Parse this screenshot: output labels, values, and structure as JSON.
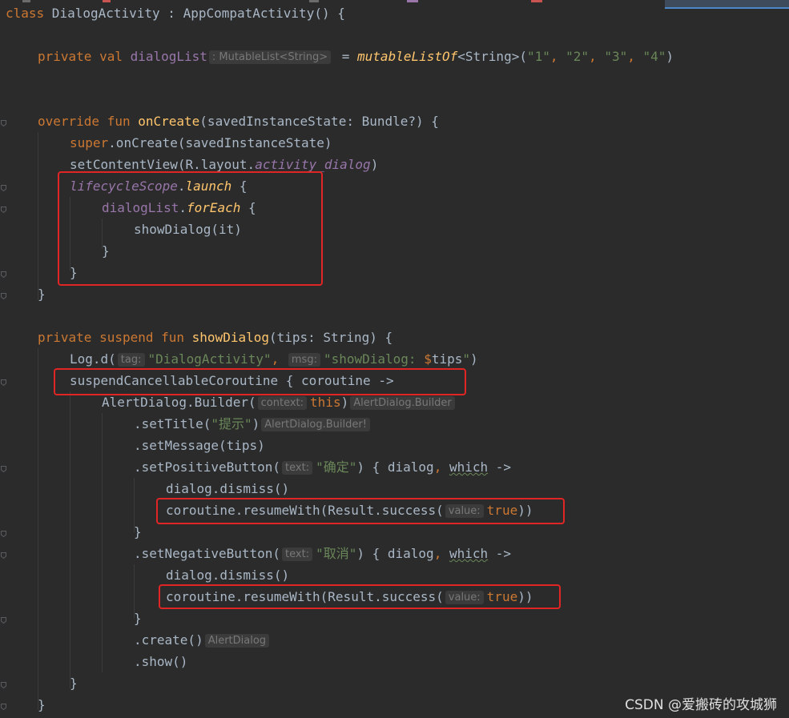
{
  "editor": {
    "language": "Kotlin",
    "lines": [
      {
        "indent": 0,
        "tokens": [
          [
            "kw",
            "class"
          ],
          [
            "p",
            " DialogActivity : AppCompatActivity() {"
          ]
        ]
      },
      {
        "indent": 0,
        "tokens": []
      },
      {
        "indent": 1,
        "tokens": [
          [
            "kw",
            "private val "
          ],
          [
            "prop",
            "dialogList"
          ],
          [
            "hint",
            ": MutableList<String>"
          ],
          [
            "p",
            " = "
          ],
          [
            "ext",
            "mutableListOf"
          ],
          [
            "p",
            "<String>("
          ],
          [
            "str",
            "\"1\""
          ],
          [
            "kw",
            ", "
          ],
          [
            "str",
            "\"2\""
          ],
          [
            "kw",
            ", "
          ],
          [
            "str",
            "\"3\""
          ],
          [
            "kw",
            ", "
          ],
          [
            "str",
            "\"4\""
          ],
          [
            "p",
            ")"
          ]
        ]
      },
      {
        "indent": 0,
        "tokens": []
      },
      {
        "indent": 0,
        "tokens": []
      },
      {
        "indent": 1,
        "tokens": [
          [
            "kw",
            "override fun "
          ],
          [
            "fn",
            "onCreate"
          ],
          [
            "p",
            "(savedInstanceState: Bundle?) {"
          ]
        ]
      },
      {
        "indent": 2,
        "tokens": [
          [
            "kw",
            "super"
          ],
          [
            "p",
            ".onCreate(savedInstanceState)"
          ]
        ]
      },
      {
        "indent": 2,
        "tokens": [
          [
            "p",
            "setContentView(R.layout."
          ],
          [
            "propi",
            "activity_dialog"
          ],
          [
            "p",
            ")"
          ]
        ]
      },
      {
        "indent": 2,
        "tokens": [
          [
            "propi",
            "lifecycleScope"
          ],
          [
            "p",
            "."
          ],
          [
            "ext",
            "launch"
          ],
          [
            "p",
            " {"
          ]
        ]
      },
      {
        "indent": 3,
        "tokens": [
          [
            "prop",
            "dialogList"
          ],
          [
            "p",
            "."
          ],
          [
            "ext",
            "forEach"
          ],
          [
            "p",
            " {"
          ]
        ]
      },
      {
        "indent": 4,
        "tokens": [
          [
            "p",
            "showDialog("
          ],
          [
            "kwb",
            "it"
          ],
          [
            "p",
            ")"
          ]
        ]
      },
      {
        "indent": 3,
        "tokens": [
          [
            "p",
            "}"
          ]
        ]
      },
      {
        "indent": 2,
        "tokens": [
          [
            "p",
            "}"
          ]
        ]
      },
      {
        "indent": 1,
        "tokens": [
          [
            "p",
            "}"
          ]
        ]
      },
      {
        "indent": 0,
        "tokens": []
      },
      {
        "indent": 1,
        "tokens": [
          [
            "kw",
            "private suspend fun "
          ],
          [
            "fn",
            "showDialog"
          ],
          [
            "p",
            "(tips: String) {"
          ]
        ]
      },
      {
        "indent": 2,
        "tokens": [
          [
            "p",
            "Log.d("
          ],
          [
            "hint",
            "tag:"
          ],
          [
            "str",
            "\"DialogActivity\""
          ],
          [
            "kw",
            ", "
          ],
          [
            "hint",
            "msg:"
          ],
          [
            "str",
            "\"showDialog: "
          ],
          [
            "kw",
            "$"
          ],
          [
            "p",
            "tips"
          ],
          [
            "str",
            "\""
          ],
          [
            "p",
            ")"
          ]
        ]
      },
      {
        "indent": 2,
        "tokens": [
          [
            "p",
            "suspendCancellableCoroutine { coroutine ->"
          ]
        ]
      },
      {
        "indent": 3,
        "tokens": [
          [
            "p",
            "AlertDialog.Builder("
          ],
          [
            "hint",
            "context:"
          ],
          [
            "kw",
            "this"
          ],
          [
            "p",
            ")"
          ],
          [
            "hint",
            "AlertDialog.Builder"
          ]
        ]
      },
      {
        "indent": 4,
        "tokens": [
          [
            "p",
            ".setTitle("
          ],
          [
            "str",
            "\"提示\""
          ],
          [
            "p",
            ")"
          ],
          [
            "hint",
            "AlertDialog.Builder!"
          ]
        ]
      },
      {
        "indent": 4,
        "tokens": [
          [
            "p",
            ".setMessage(tips)"
          ]
        ]
      },
      {
        "indent": 4,
        "tokens": [
          [
            "p",
            ".setPositiveButton("
          ],
          [
            "hint",
            "text:"
          ],
          [
            "str",
            "\"确定\""
          ],
          [
            "p",
            ") { dialog"
          ],
          [
            "kw",
            ", "
          ],
          [
            "param",
            "which"
          ],
          [
            "p",
            " ->"
          ]
        ]
      },
      {
        "indent": 5,
        "tokens": [
          [
            "p",
            "dialog.dismiss()"
          ]
        ]
      },
      {
        "indent": 5,
        "tokens": [
          [
            "p",
            "coroutine.resumeWith(Result.success("
          ],
          [
            "hint",
            "value:"
          ],
          [
            "kw",
            "true"
          ],
          [
            "p",
            "))"
          ]
        ]
      },
      {
        "indent": 4,
        "tokens": [
          [
            "p",
            "}"
          ]
        ]
      },
      {
        "indent": 4,
        "tokens": [
          [
            "p",
            ".setNegativeButton("
          ],
          [
            "hint",
            "text:"
          ],
          [
            "str",
            "\"取消\""
          ],
          [
            "p",
            ") { dialog"
          ],
          [
            "kw",
            ", "
          ],
          [
            "param",
            "which"
          ],
          [
            "p",
            " ->"
          ]
        ]
      },
      {
        "indent": 5,
        "tokens": [
          [
            "p",
            "dialog.dismiss()"
          ]
        ]
      },
      {
        "indent": 5,
        "tokens": [
          [
            "p",
            "coroutine.resumeWith(Result.success("
          ],
          [
            "hint",
            "value:"
          ],
          [
            "kw",
            "true"
          ],
          [
            "p",
            "))"
          ]
        ]
      },
      {
        "indent": 4,
        "tokens": [
          [
            "p",
            "}"
          ]
        ]
      },
      {
        "indent": 4,
        "tokens": [
          [
            "p",
            ".create()"
          ],
          [
            "hint",
            "AlertDialog"
          ]
        ]
      },
      {
        "indent": 4,
        "tokens": [
          [
            "p",
            ".show()"
          ]
        ]
      },
      {
        "indent": 2,
        "tokens": [
          [
            "p",
            "}"
          ]
        ]
      },
      {
        "indent": 1,
        "tokens": [
          [
            "p",
            "}"
          ]
        ]
      }
    ]
  },
  "highlight_color": "#e02525",
  "watermark": "CSDN @爱搬砖的攻城狮"
}
